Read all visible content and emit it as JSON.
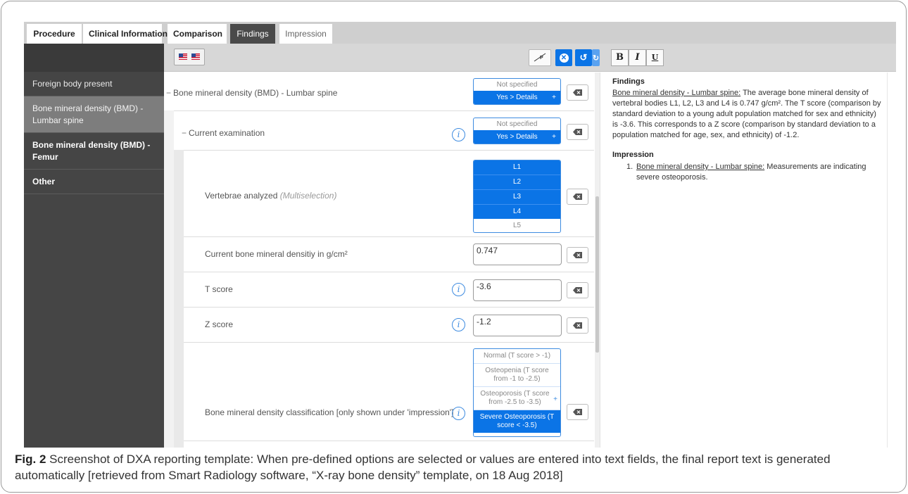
{
  "tabs": [
    {
      "label": "Procedure",
      "state": "default"
    },
    {
      "label": "Clinical Information",
      "state": "default"
    },
    {
      "label": "Comparison",
      "state": "default"
    },
    {
      "label": "Findings",
      "state": "active"
    },
    {
      "label": "Impression",
      "state": "plain"
    }
  ],
  "sidebar": {
    "items": [
      {
        "label": "Foreign body present",
        "selected": false,
        "bold": false
      },
      {
        "label": "Bone mineral density (BMD) - Lumbar spine",
        "selected": true,
        "bold": false
      },
      {
        "label": "Bone mineral density (BMD) - Femur",
        "selected": false,
        "bold": true
      },
      {
        "label": "Other",
        "selected": false,
        "bold": true
      }
    ]
  },
  "toolbar": {
    "language_flags": [
      "us-flag-icon",
      "us-flag-icon"
    ],
    "buttons": [
      "signature-icon",
      "cancel-icon",
      "undo-icon",
      "redo-icon"
    ]
  },
  "form": {
    "rows": [
      {
        "label": "Bone mineral density (BMD) - Lumbar spine",
        "prefix": "−"
      },
      {
        "label": "Current examination",
        "prefix": "−"
      },
      {
        "label": "Vertebrae analyzed",
        "note": "(Multiselection)"
      },
      {
        "label": "Current bone mineral densitiy in g/cm²"
      },
      {
        "label": "T score"
      },
      {
        "label": "Z score"
      },
      {
        "label": "Bone mineral density classification [only shown under 'impression']"
      }
    ],
    "yesno": {
      "not_specified": "Not specified",
      "yes": "Yes > Details",
      "plus": "+"
    },
    "vertebrae": [
      {
        "label": "L1",
        "selected": true
      },
      {
        "label": "L2",
        "selected": true
      },
      {
        "label": "L3",
        "selected": true
      },
      {
        "label": "L4",
        "selected": true
      },
      {
        "label": "L5",
        "selected": false
      }
    ],
    "values": {
      "bmd": "0.747",
      "t_score": "-3.6",
      "z_score": "-1.2"
    },
    "classification": [
      {
        "label": "Normal (T score > -1)",
        "selected": false
      },
      {
        "label": "Osteopenia (T score from -1 to -2.5)",
        "selected": false
      },
      {
        "label": "Osteoporosis (T score from -2.5 to -3.5)",
        "selected": false
      },
      {
        "label": "Severe Osteoporosis (T score < -3.5)",
        "selected": true
      }
    ],
    "info_glyph": "i"
  },
  "editor": {
    "format_buttons": [
      "B",
      "I",
      "U"
    ],
    "findings_heading": "Findings",
    "findings_link": "Bone mineral density - Lumbar spine:",
    "findings_text": " The average bone mineral density of vertebral bodies L1, L2, L3 and L4 is 0.747 g/cm². The T score (comparison by standard deviation to a young adult population matched for sex and ethnicity) is -3.6. This corresponds to a Z score (comparison by standard deviation to a population matched for age, sex, and ethnicity) of -1.2.",
    "impression_heading": "Impression",
    "impression_number": "1.",
    "impression_link": "Bone mineral density - Lumbar spine:",
    "impression_text": " Measurements are indicating severe osteoporosis."
  },
  "caption": {
    "label": "Fig. 2",
    "text": " Screenshot of DXA reporting template: When pre-defined options are selected or values are entered into text fields, the final report text is generated automatically [retrieved from Smart Radiology software, “X-ray bone density” template, on 18 Aug 2018]"
  },
  "colors": {
    "accent": "#0b74e6",
    "sidebar": "#454545",
    "toolbar": "#d7d7d7"
  }
}
